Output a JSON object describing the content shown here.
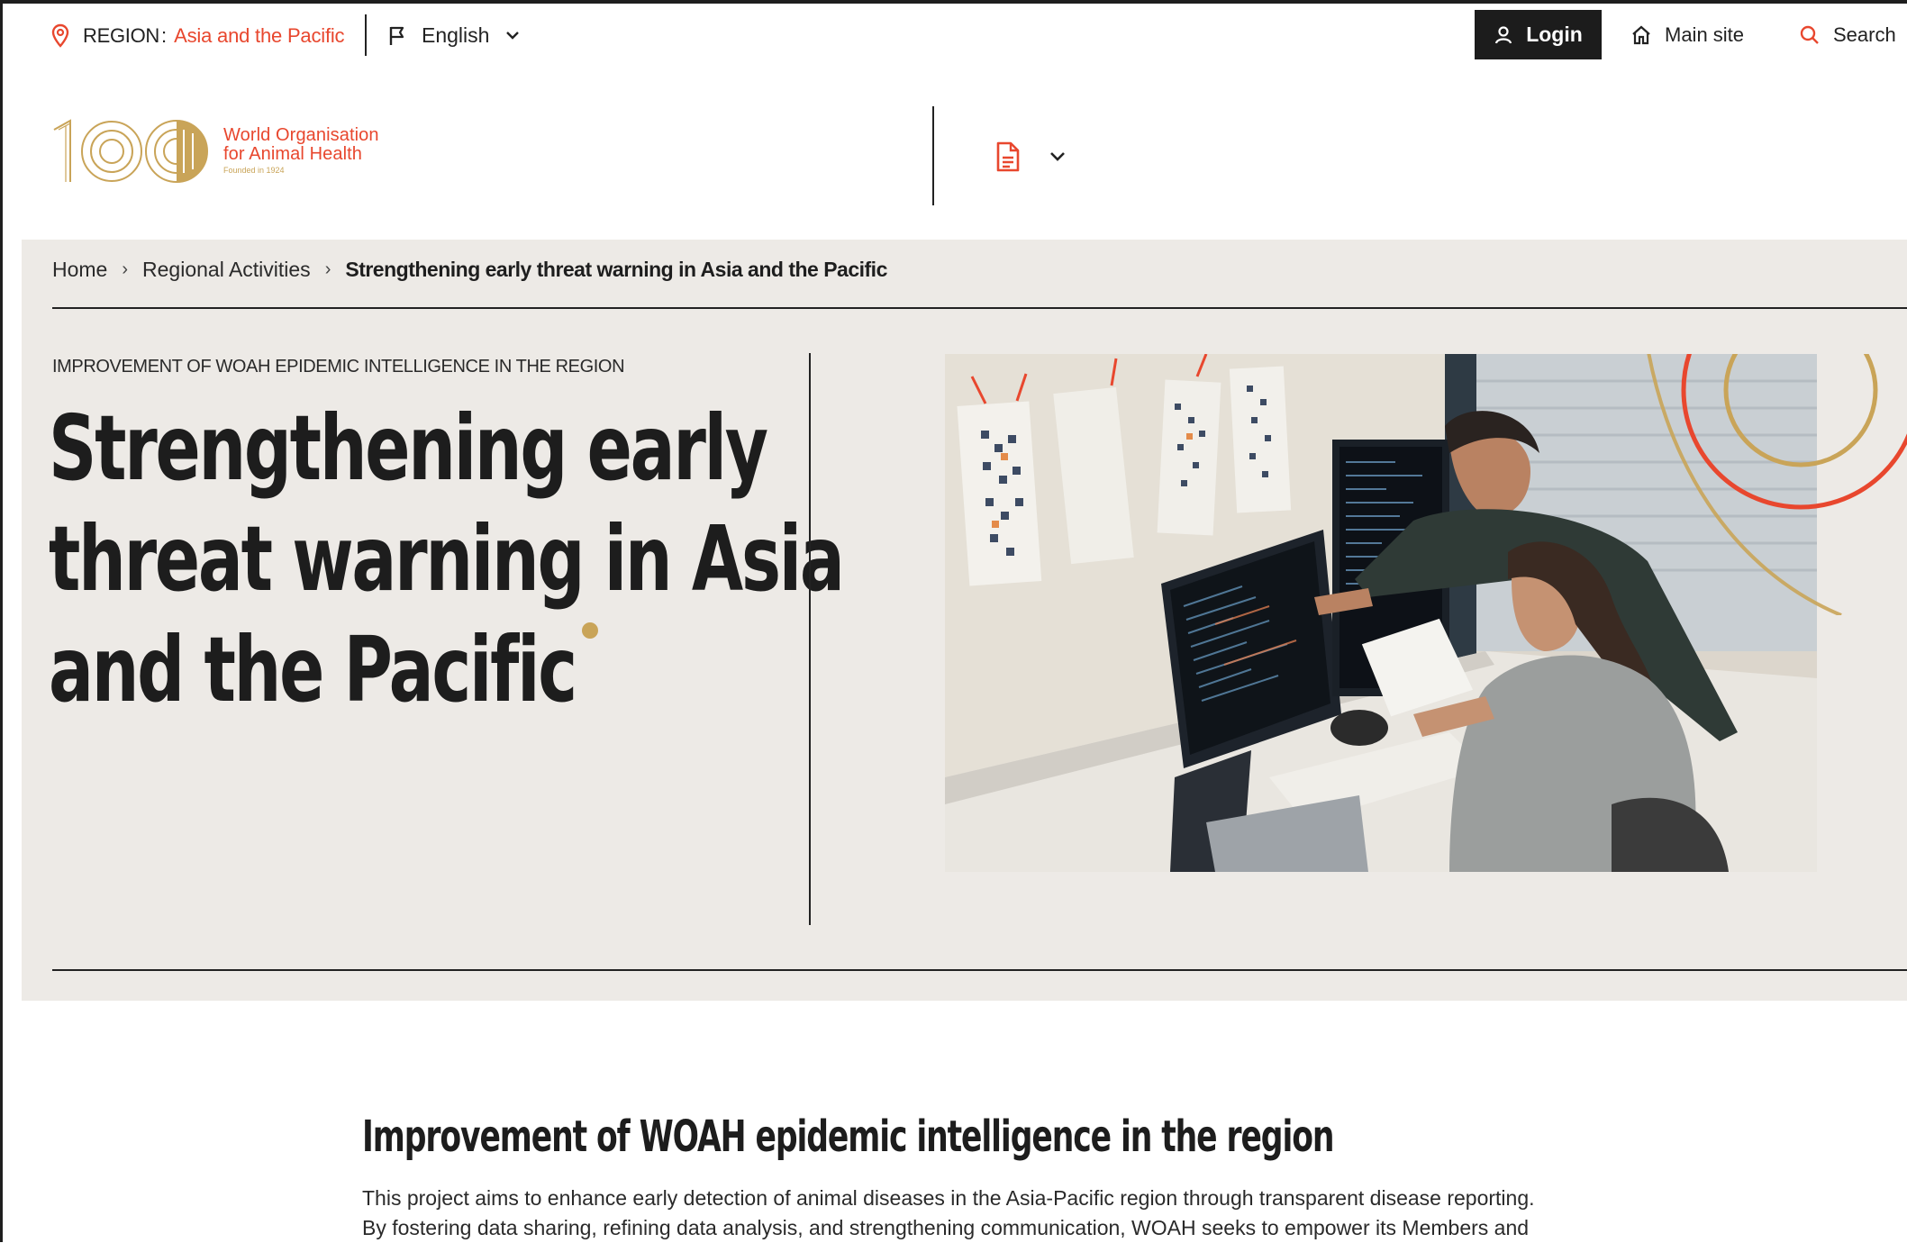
{
  "utility_bar": {
    "region_label": "REGION",
    "region_colon": ":",
    "region_value": "Asia and the Pacific",
    "language": "English",
    "login_label": "Login",
    "main_site_label": "Main site",
    "search_label": "Search"
  },
  "header": {
    "logo_number": "100",
    "logo_name_line1": "World Organisation",
    "logo_name_line2": "for Animal Health",
    "logo_founded": "Founded in 1924"
  },
  "breadcrumb": {
    "home": "Home",
    "separator": "›",
    "regional": "Regional Activities",
    "current": "Strengthening early threat warning in Asia and the Pacific"
  },
  "hero": {
    "kicker": "IMPROVEMENT OF WOAH EPIDEMIC INTELLIGENCE IN THE REGION",
    "title_line1": "Strengthening early",
    "title_line2": "threat warning in Asia",
    "title_line3": "and the Pacific",
    "image_alt": "Two people reviewing code on computer monitors"
  },
  "content": {
    "section_title": "Improvement of WOAH epidemic intelligence in the region",
    "paragraph_line1": "This project aims to enhance early detection of animal diseases in the Asia-Pacific region through transparent disease reporting.",
    "paragraph_line2": "By fostering data sharing, refining data analysis, and strengthening communication, WOAH seeks to empower its Members and"
  },
  "colors": {
    "accent_red": "#e8472e",
    "accent_gold": "#c9a458",
    "hero_bg": "#edeae6",
    "ink": "#1d1d1d"
  },
  "icons": {
    "region": "map-pin-icon",
    "language": "flag-icon",
    "login": "user-icon",
    "main_site": "home-icon",
    "search": "search-icon",
    "document": "document-icon"
  }
}
